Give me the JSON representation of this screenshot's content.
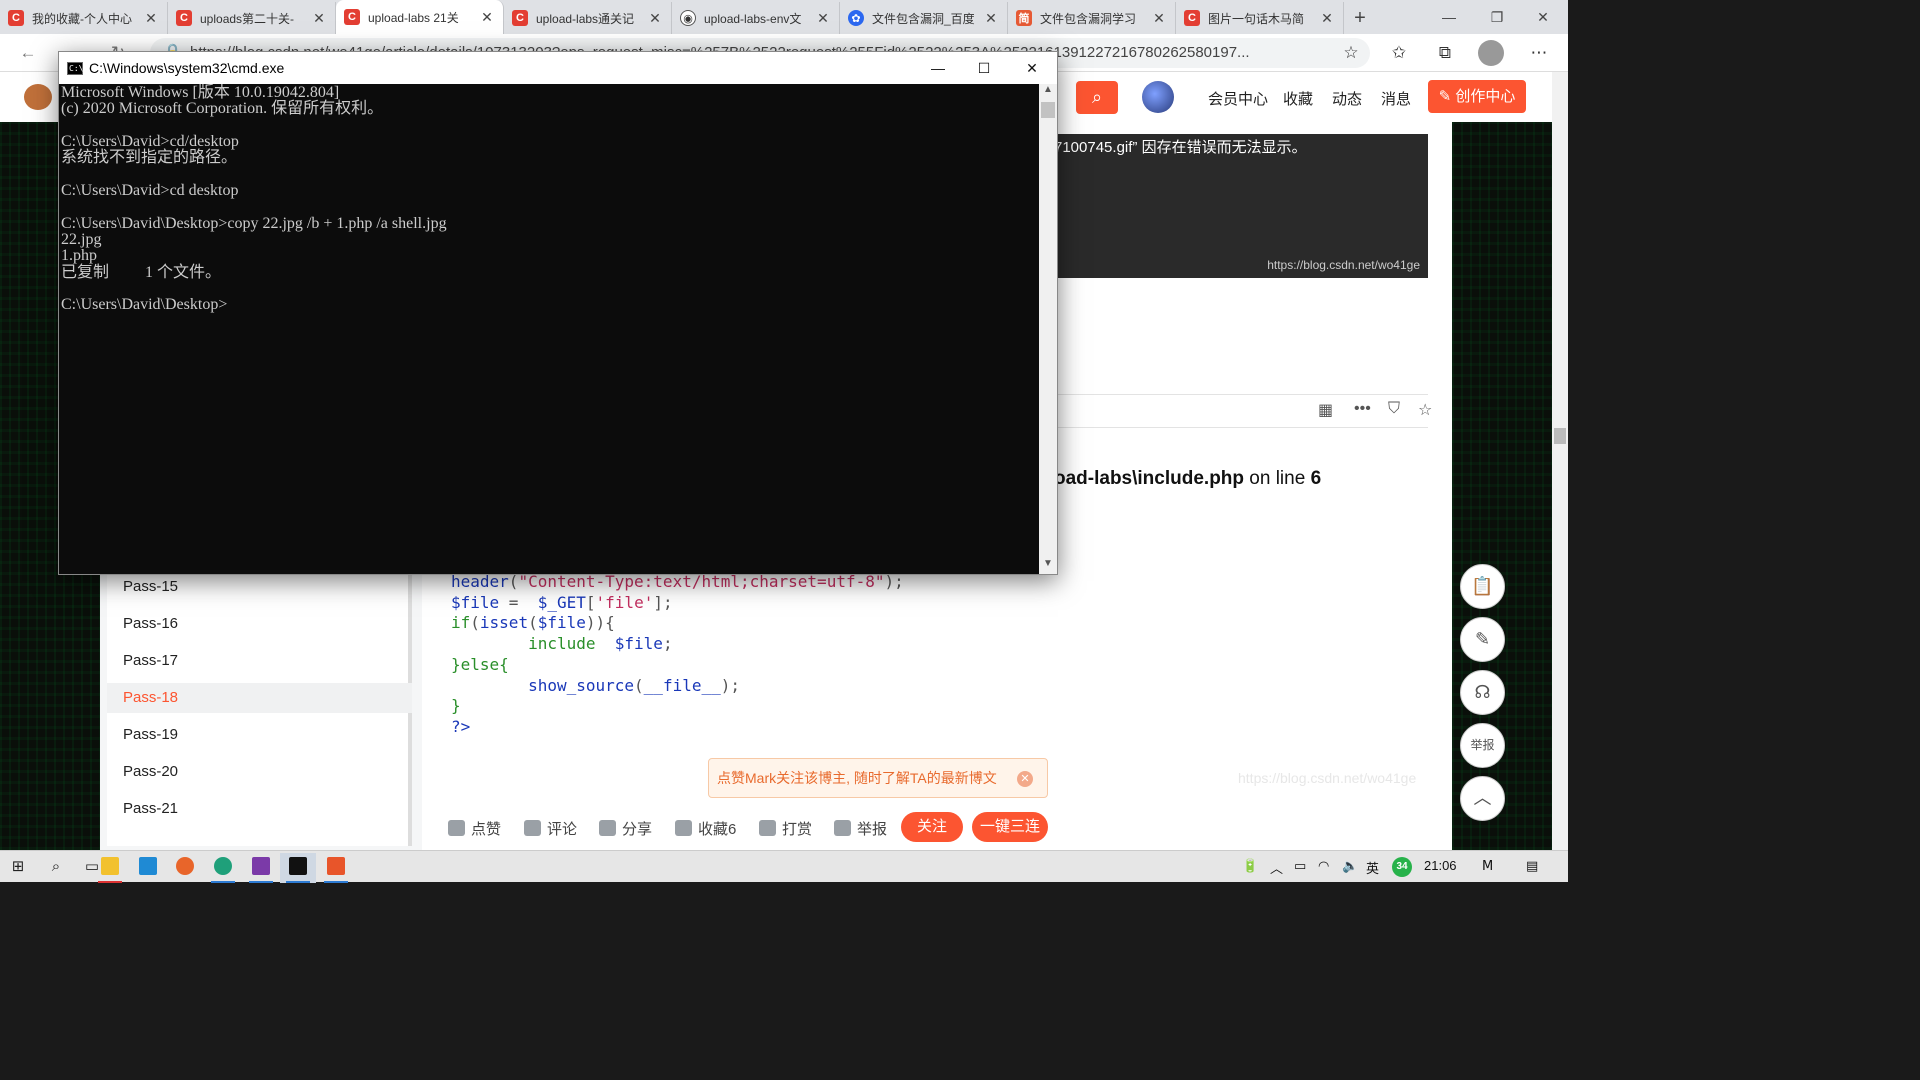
{
  "browser": {
    "tabs": [
      {
        "title": "我的收藏-个人中心",
        "favicon": "C"
      },
      {
        "title": "uploads第二十关-",
        "favicon": "C"
      },
      {
        "title": "upload-labs 21关",
        "favicon": "C"
      },
      {
        "title": "upload-labs通关记",
        "favicon": "C"
      },
      {
        "title": "upload-labs-env文",
        "favicon": "github"
      },
      {
        "title": "文件包含漏洞_百度",
        "favicon": "baidu"
      },
      {
        "title": "文件包含漏洞学习",
        "favicon": "简"
      },
      {
        "title": "图片一句话木马简",
        "favicon": "C"
      }
    ],
    "active_tab": 2,
    "new_tab": "+",
    "url": "https://blog.csdn.net/wo41ge/article/details/107313203?ops_request_misc=%257B%2522request%255Fid%2522%253A%252216139122721678026258019​7..."
  },
  "csdn_header": {
    "links": [
      "会员中心",
      "收藏",
      "动态",
      "消息"
    ],
    "create_label": "创作中心"
  },
  "article": {
    "img_error": "7100745.gif” 因存在错误而无法显示。",
    "img_watermark": "https://blog.csdn.net/wo41ge",
    "warning_path": "oad-labs\\include.php",
    "warning_on": "on line",
    "warning_line": "6",
    "code": {
      "l1_fn": "header",
      "l1_str": "\"Content-Type:text/html;charset=utf-8\"",
      "l2_var": "$file",
      "l2_op": " = ",
      "l2_get": "$_GET",
      "l2_key": "'file'",
      "l3_kw": "if",
      "l3_fn": "isset",
      "l3_var": "$file",
      "l4_kw": "include",
      "l4_var": "$file",
      "l5_kw": "}else{",
      "l6_fn": "show_source",
      "l6_arg": "__file__",
      "l7": "}",
      "l8": "?>"
    },
    "follow_tip": "点赞Mark关注该博主, 随时了解TA的最新博文",
    "watermark2": "https://blog.csdn.net/wo41ge"
  },
  "sidebar": {
    "items": [
      "Pass-15",
      "Pass-16",
      "Pass-17",
      "Pass-18",
      "Pass-19",
      "Pass-20",
      "Pass-21"
    ],
    "active": "Pass-18"
  },
  "toolbar": {
    "like": "点赞",
    "comment": "评论",
    "share": "分享",
    "collect": "收藏6",
    "reward": "打赏",
    "report": "举报",
    "follow": "关注",
    "triple": "一键三连"
  },
  "float_buttons": {
    "report": "举报"
  },
  "cmd": {
    "title": "C:\\Windows\\system32\\cmd.exe",
    "lines": [
      "Microsoft Windows [版本 10.0.19042.804]",
      "(c) 2020 Microsoft Corporation. 保留所有权利。",
      "",
      "C:\\Users\\David>cd/desktop",
      "系统找不到指定的路径。",
      "",
      "C:\\Users\\David>cd desktop",
      "",
      "C:\\Users\\David\\Desktop>copy 22.jpg /b + 1.php /a shell.jpg",
      "22.jpg",
      "1.php",
      "已复制         1 个文件。",
      "",
      "C:\\Users\\David\\Desktop>"
    ]
  },
  "taskbar": {
    "ime": "英",
    "badge": "34",
    "time": "21:06"
  },
  "colors": {
    "csdn_red": "#fc5531",
    "cmd_bg": "#0c0c0c",
    "cmd_fg": "#cccccc"
  }
}
